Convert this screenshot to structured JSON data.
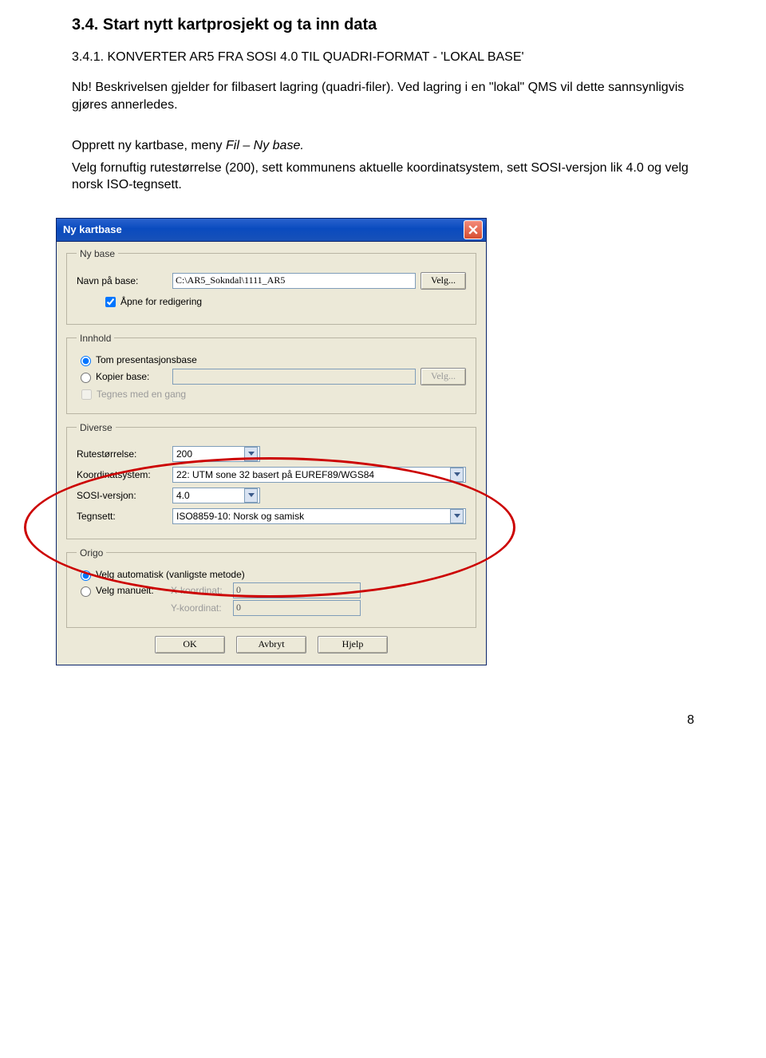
{
  "doc": {
    "heading": "3.4. Start nytt kartprosjekt og ta inn data",
    "subheading": "3.4.1.  KONVERTER AR5 FRA SOSI 4.0 TIL QUADRI-FORMAT - 'LOKAL BASE'",
    "para1": "Nb! Beskrivelsen gjelder for filbasert lagring (quadri-filer). Ved lagring i en \"lokal\" QMS vil dette sannsynligvis gjøres annerledes.",
    "para2a": "Opprett ny kartbase, meny ",
    "para2b": "Fil – Ny base.",
    "para3": "Velg fornuftig rutestørrelse (200), sett kommunens aktuelle koordinatsystem, sett SOSI-versjon lik 4.0 og velg norsk ISO-tegnsett.",
    "pageNumber": "8"
  },
  "dlg": {
    "title": "Ny kartbase",
    "nybase": {
      "legend": "Ny base",
      "navn_label": "Navn på base:",
      "navn_value": "C:\\AR5_Sokndal\\1111_AR5",
      "velg": "Velg...",
      "aapne": "Åpne for redigering"
    },
    "innhold": {
      "legend": "Innhold",
      "tom": "Tom presentasjonsbase",
      "kopier": "Kopier base:",
      "velg": "Velg...",
      "tegnes": "Tegnes med en gang"
    },
    "diverse": {
      "legend": "Diverse",
      "rute_label": "Rutestørrelse:",
      "rute_value": "200",
      "koord_label": "Koordinatsystem:",
      "koord_value": "22: UTM sone 32 basert på EUREF89/WGS84",
      "sosi_label": "SOSI-versjon:",
      "sosi_value": "4.0",
      "tegn_label": "Tegnsett:",
      "tegn_value": "ISO8859-10: Norsk og samisk"
    },
    "origo": {
      "legend": "Origo",
      "auto": "Velg automatisk (vanligste metode)",
      "man": "Velg manuelt:",
      "x_label": "X-koordinat:",
      "x_value": "0",
      "y_label": "Y-koordinat:",
      "y_value": "0"
    },
    "buttons": {
      "ok": "OK",
      "cancel": "Avbryt",
      "help": "Hjelp"
    }
  }
}
